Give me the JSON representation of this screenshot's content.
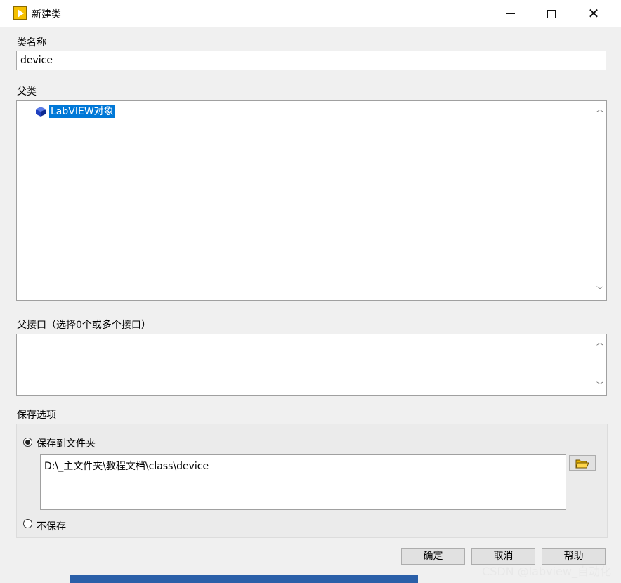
{
  "window": {
    "title": "新建类",
    "minimize_icon": "minimize-icon",
    "maximize_icon": "maximize-icon",
    "close_icon": "close-icon",
    "close_glyph": "✕"
  },
  "class_name": {
    "label": "类名称",
    "value": "device"
  },
  "parent_class": {
    "label": "父类",
    "items": [
      {
        "label": "LabVIEW对象",
        "icon": "blue-cube-icon",
        "selected": true
      }
    ]
  },
  "parent_interfaces": {
    "label": "父接口（选择0个或多个接口）"
  },
  "scroll": {
    "up_glyph": "︿",
    "down_glyph": "﹀"
  },
  "save_options": {
    "label": "保存选项",
    "save_to_folder_label": "保存到文件夹",
    "path_value": "D:\\_主文件夹\\教程文档\\class\\device",
    "browse_icon": "folder-open-icon",
    "no_save_label": "不保存",
    "selected": "save_to_folder"
  },
  "buttons": {
    "ok": "确定",
    "cancel": "取消",
    "help": "帮助"
  },
  "watermark": "CSDN @labview_自动化",
  "colors": {
    "selection": "#0078d7",
    "icon_yellow": "#f5c000",
    "cube_blue": "#1f3fbf"
  }
}
